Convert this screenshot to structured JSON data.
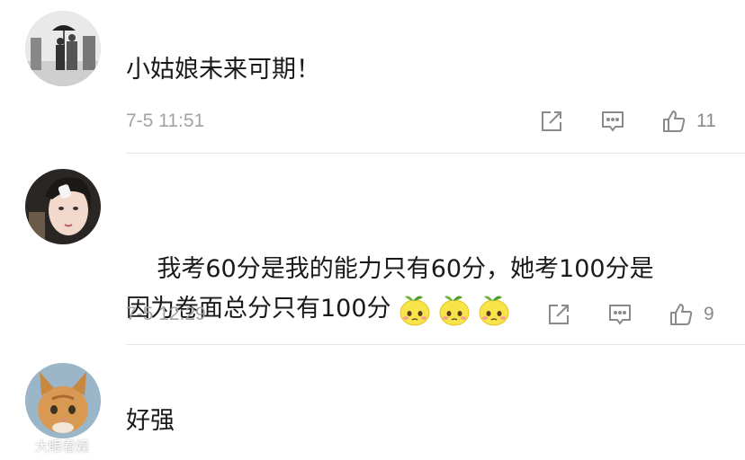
{
  "comments": [
    {
      "text": "小姑娘未来可期！",
      "time": "7-5 11:51",
      "likes": "11",
      "avatar": "avatar-couple-umbrella-bw"
    },
    {
      "text": "我考60分是我的能力只有60分，她考100分是\n因为卷面总分只有100分",
      "emojis": [
        "lemon-emoji",
        "lemon-emoji",
        "lemon-emoji"
      ],
      "time": "7-5 12:29",
      "likes": "9",
      "avatar": "avatar-girl-portrait"
    },
    {
      "text": "好强",
      "avatar": "avatar-cat"
    }
  ],
  "icons": {
    "share": "share-icon",
    "reply": "comment-icon",
    "like": "thumbs-up-icon"
  },
  "watermark": {
    "text": "大眼看娱"
  },
  "colors": {
    "text": "#1a1a1a",
    "meta": "#a3a3a3",
    "icon": "#8a8a8a",
    "divider": "#e6e6e6"
  }
}
